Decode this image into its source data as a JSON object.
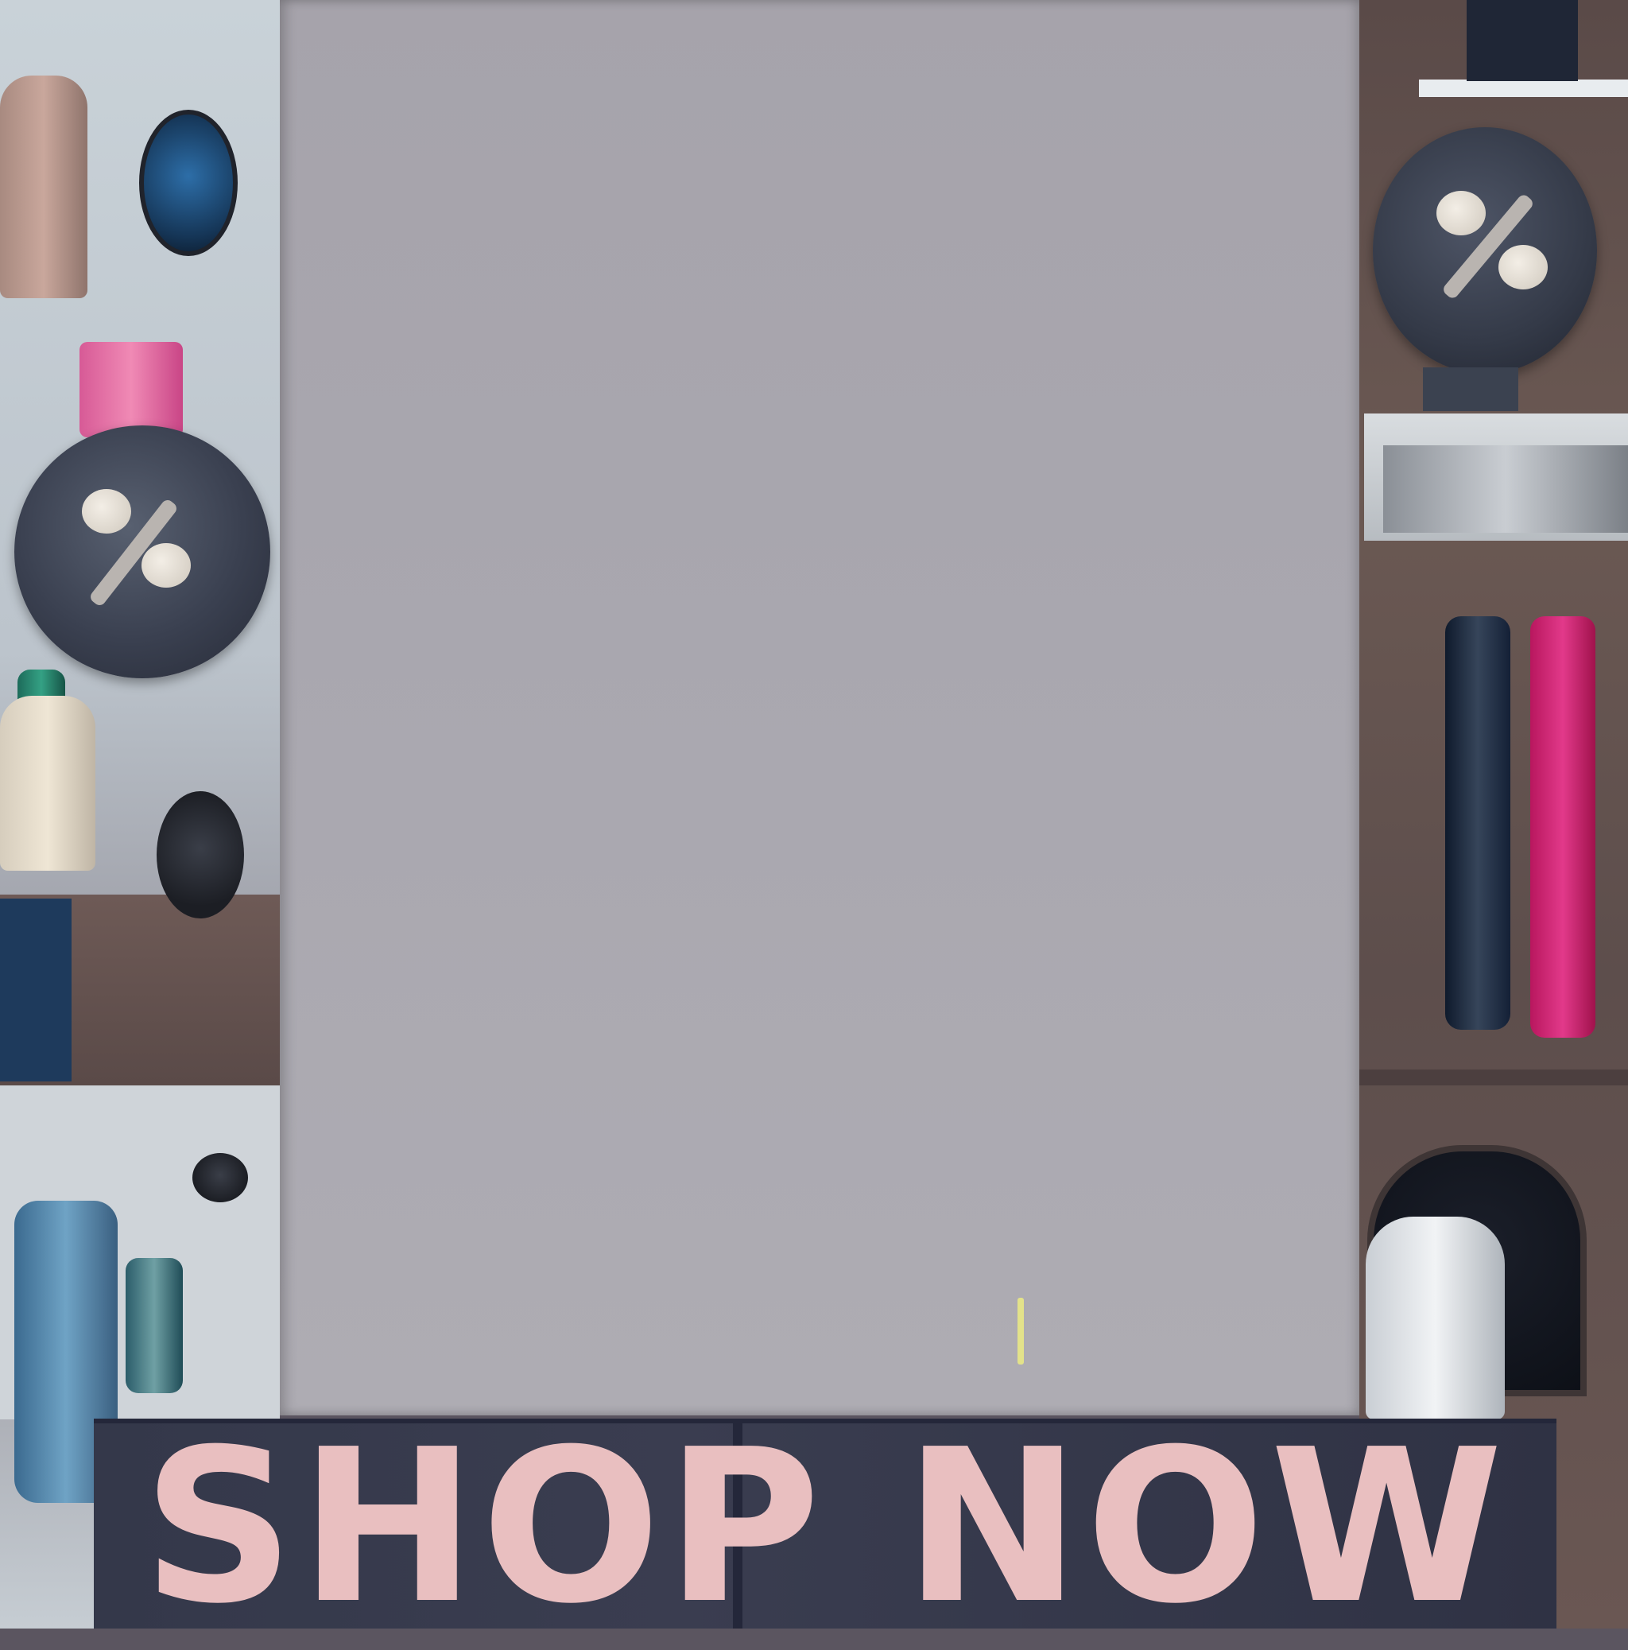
{
  "banner": {
    "text": "SHOP NOW",
    "text_color": "#e9bfc0"
  },
  "palette": {
    "board": "#a9a7af",
    "banner_background": "#34384a",
    "accent_pink": "#e2398a",
    "accent_blue": "#2d6ea8"
  },
  "discount_icons": [
    "percent-sign-icon",
    "percent-sign-icon"
  ]
}
